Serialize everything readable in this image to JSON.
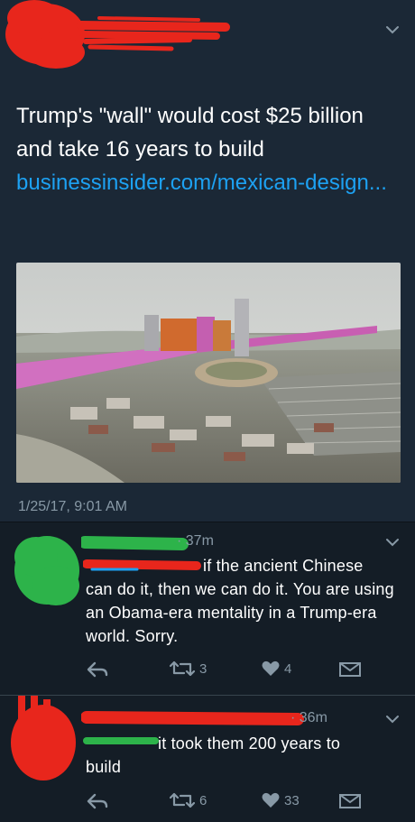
{
  "tweet": {
    "text": "Trump's \"wall\" would cost $25 billion and take 16 years to build",
    "link": "businessinsider.com/mexican-design...",
    "timestamp": "1/25/17, 9:01 AM"
  },
  "replies": [
    {
      "time": "· 37m",
      "text_first": "if the ancient Chinese",
      "text_rest": "can do it, then we can do it. You are using an Obama-era mentality in a Trump-era world. Sorry.",
      "retweets": "3",
      "likes": "4"
    },
    {
      "time": "· 36m",
      "text_first": "it took them 200 years to",
      "text_rest": "build",
      "retweets": "6",
      "likes": "33"
    }
  ],
  "colors": {
    "background": "#141d26",
    "tweet_background": "#1b2836",
    "link": "#1da1f2",
    "muted": "#8899a6",
    "redaction_red": "#e8261c",
    "redaction_green": "#2db34a"
  },
  "icons": [
    "chevron-down-icon",
    "reply-icon",
    "retweet-icon",
    "heart-icon",
    "direct-message-icon"
  ]
}
